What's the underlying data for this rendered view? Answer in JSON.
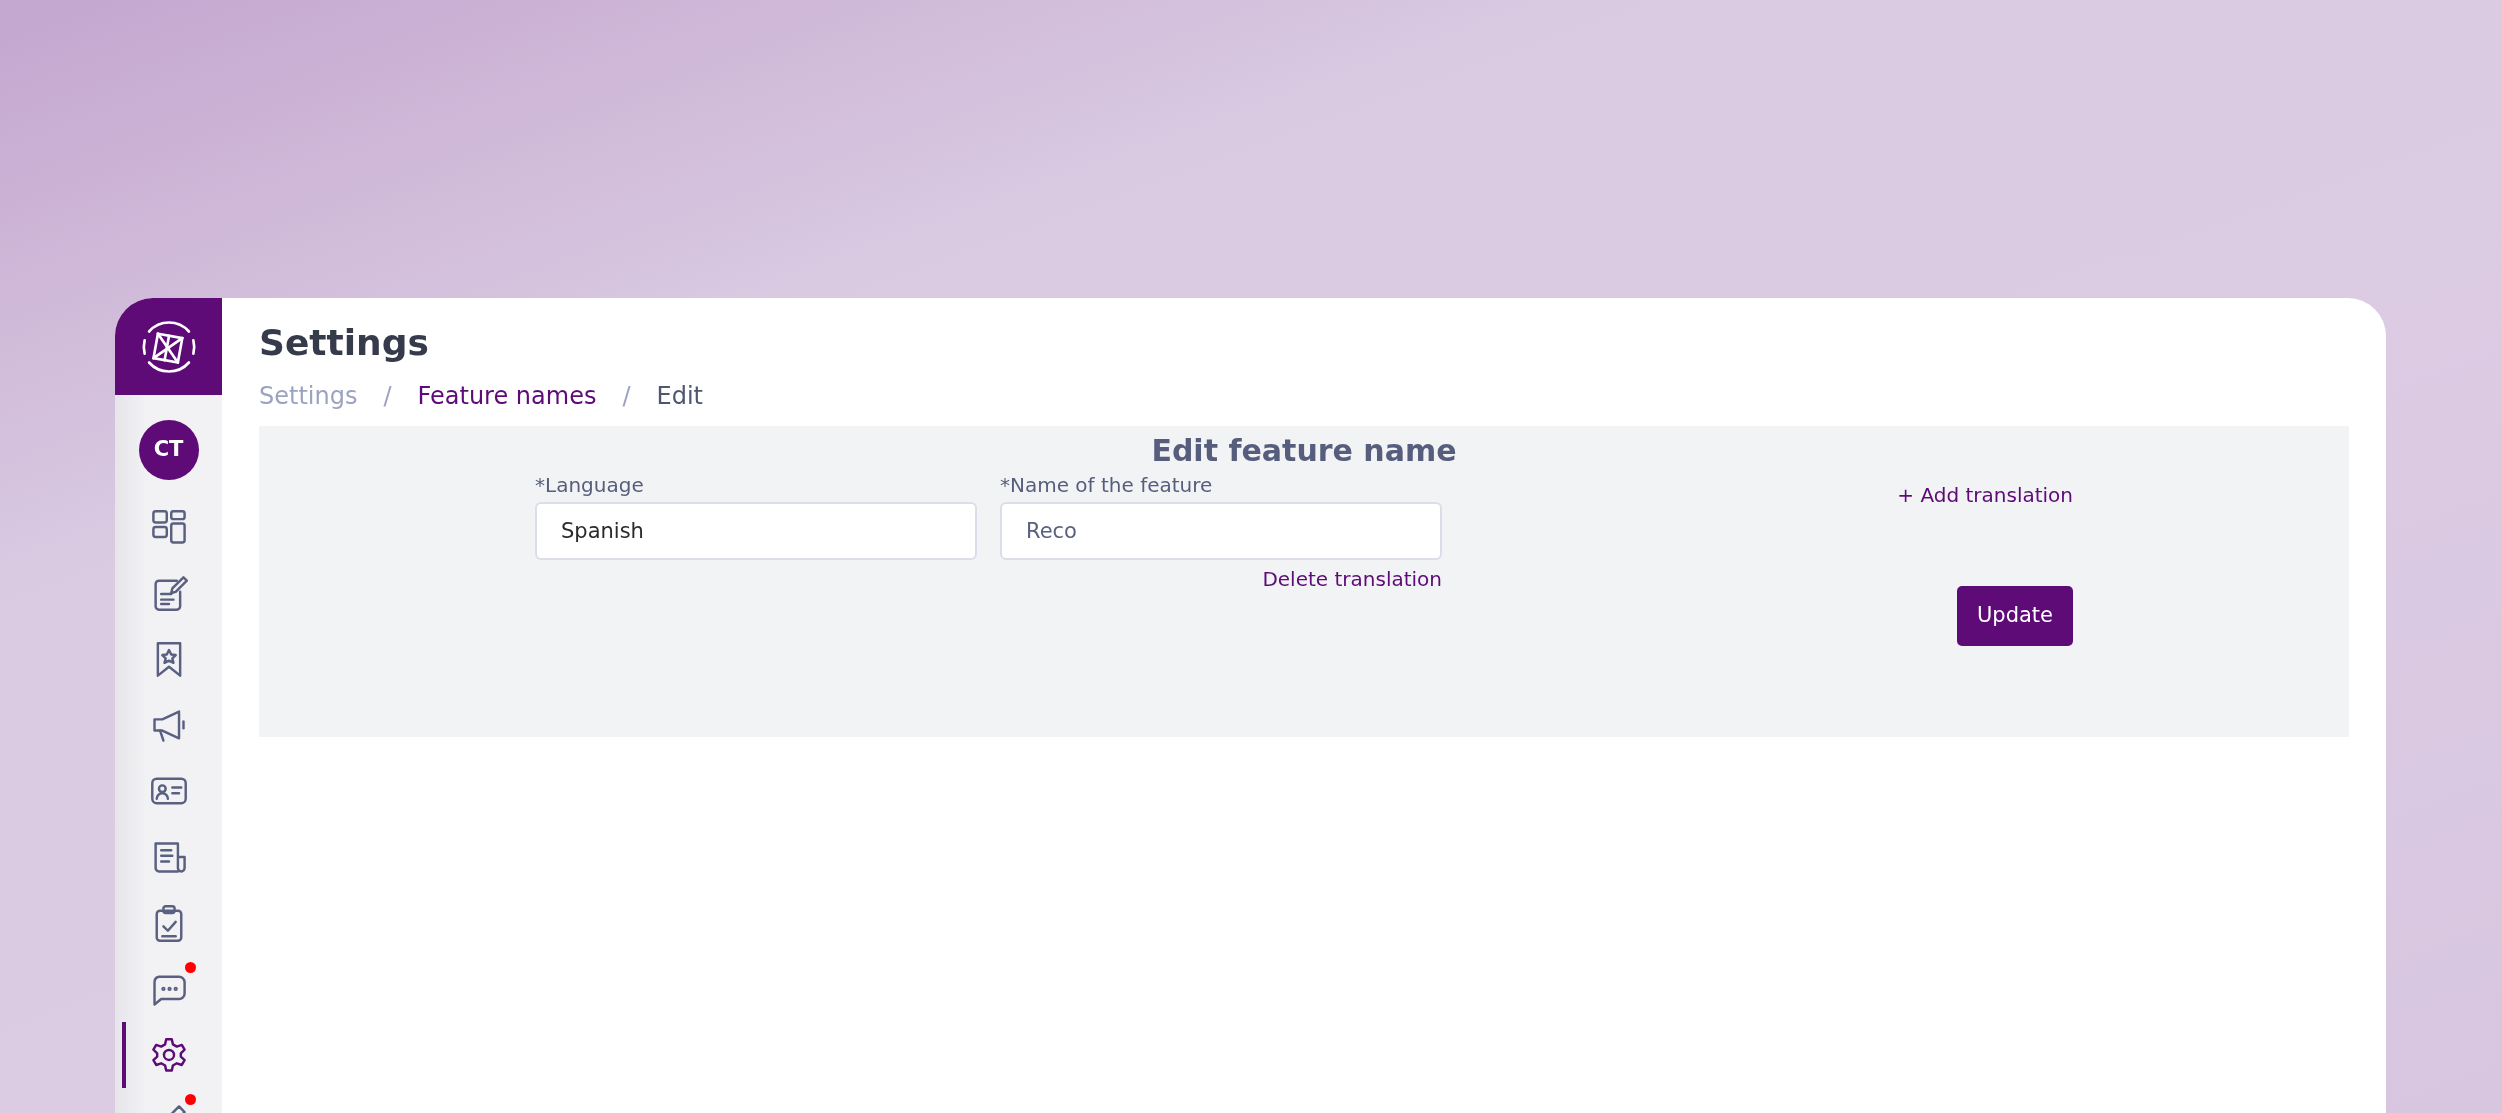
{
  "sidebar": {
    "avatar": "CT",
    "items": [
      {
        "selected": false,
        "notification": false
      },
      {
        "selected": false,
        "notification": false
      },
      {
        "selected": false,
        "notification": false
      },
      {
        "selected": false,
        "notification": false
      },
      {
        "selected": false,
        "notification": false
      },
      {
        "selected": false,
        "notification": false
      },
      {
        "selected": false,
        "notification": false
      },
      {
        "selected": false,
        "notification": true
      },
      {
        "selected": true,
        "notification": false
      },
      {
        "selected": false,
        "notification": true
      }
    ]
  },
  "page": {
    "title": "Settings",
    "breadcrumb": [
      {
        "kind": "root",
        "label": "Settings"
      },
      {
        "kind": "separator",
        "label": "/"
      },
      {
        "kind": "link",
        "label": "Feature names"
      },
      {
        "kind": "separator",
        "label": "/"
      },
      {
        "kind": "current",
        "label": "Edit"
      }
    ]
  },
  "form": {
    "title": "Edit feature name",
    "fields": [
      {
        "kind": "select",
        "label": "*Language",
        "value": "Spanish"
      },
      {
        "kind": "text",
        "label": "*Name of the feature",
        "value": "Reco"
      }
    ],
    "delete_link": "Delete translation",
    "add_link": "+ Add translation",
    "submit": "Update"
  }
}
